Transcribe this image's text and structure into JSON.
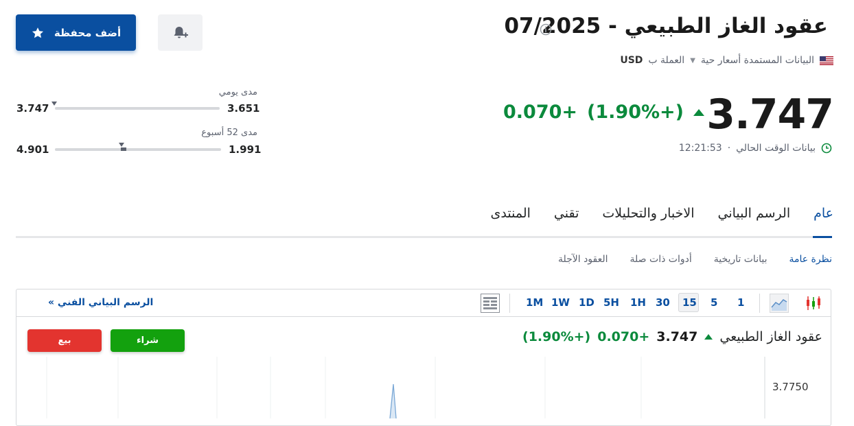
{
  "header": {
    "title": "عقود الغاز الطبيعي - 07/2025",
    "data_source": "البيانات المستمدة أسعار حية",
    "currency_label": "العملة ب",
    "currency_code": "USD",
    "watchlist_label": "أضف محفظة"
  },
  "quote": {
    "price": "3.747",
    "change": "+0.070",
    "change_pct": "(+1.90%)",
    "time_label": "بيانات الوقت الحالي",
    "time": "12:21:53"
  },
  "ranges": {
    "daily": {
      "label": "مدى يومي",
      "low": "3.651",
      "high": "3.747",
      "position": 1.0
    },
    "week52": {
      "label": "مدى 52 أسبوع",
      "low": "1.991",
      "high": "4.901",
      "position": 0.6
    }
  },
  "tabs": [
    {
      "label": "عام",
      "active": true
    },
    {
      "label": "الرسم البياني",
      "active": false
    },
    {
      "label": "الاخبار والتحليلات",
      "active": false
    },
    {
      "label": "تقني",
      "active": false
    },
    {
      "label": "المنتدى",
      "active": false
    }
  ],
  "subtabs": [
    {
      "label": "نظرة عامة",
      "active": true
    },
    {
      "label": "بيانات تاريخية",
      "active": false
    },
    {
      "label": "أدوات ذات صلة",
      "active": false
    },
    {
      "label": "العقود الآجلة",
      "active": false
    }
  ],
  "chart_toolbar": {
    "intervals": [
      "1",
      "5",
      "15",
      "30",
      "1H",
      "5H",
      "1D",
      "1W",
      "1M"
    ],
    "active_interval": "15",
    "tech_link": "الرسم البياني الفني »"
  },
  "chart": {
    "name": "عقود الغاز الطبيعي",
    "price": "3.747",
    "change": "+0.070",
    "change_pct": "(+1.90%)",
    "buy_label": "شراء",
    "sell_label": "بيع",
    "y_tick": "3.7750"
  },
  "colors": {
    "accent": "#0a4fa0",
    "up": "#0b8a3c",
    "buy": "#13a10e",
    "sell": "#e3342f"
  },
  "icons": [
    "info-icon",
    "us-flag-icon",
    "star-icon",
    "bell-plus-icon",
    "clock-icon",
    "candlestick-icon",
    "area-chart-icon",
    "layout-icon"
  ]
}
